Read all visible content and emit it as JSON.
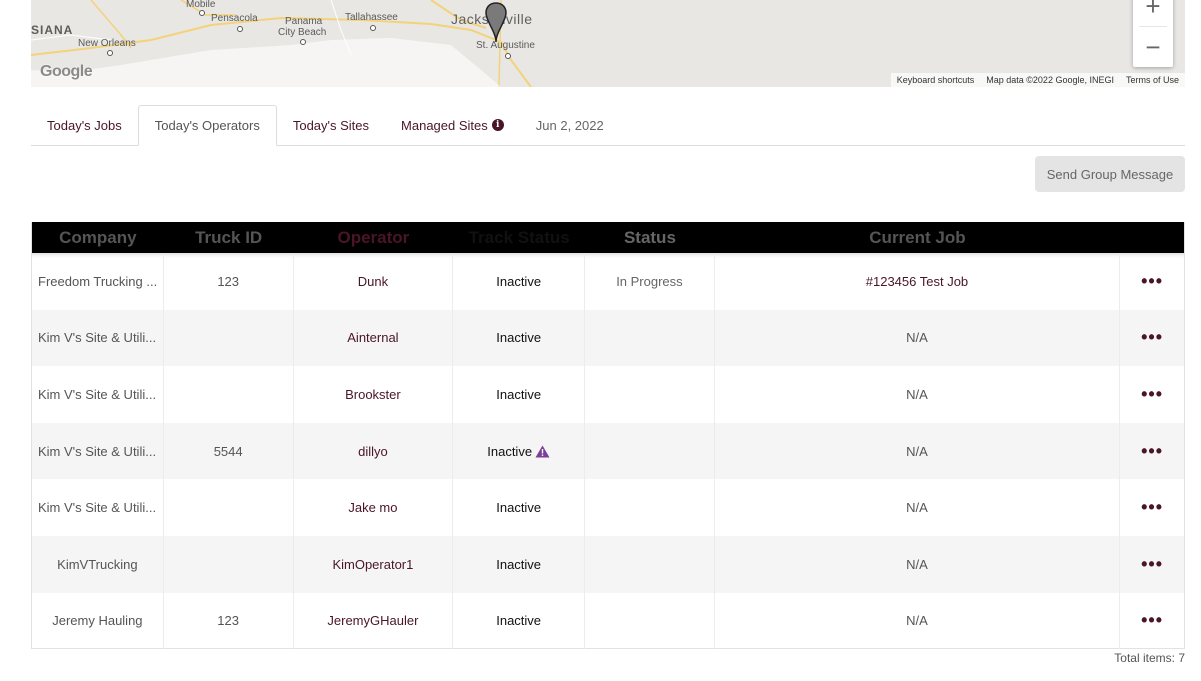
{
  "map": {
    "labels": {
      "mobile": "Mobile",
      "pensacola": "Pensacola",
      "panama": "Panama",
      "city_beach": "City Beach",
      "tallahassee": "Tallahassee",
      "jacksonville": "Jacksonville",
      "st_augustine": "St. Augustine",
      "state": "SIANA",
      "new_orleans": "New Orleans"
    },
    "google_logo": "Google",
    "attribution": {
      "shortcuts": "Keyboard shortcuts",
      "map_data": "Map data ©2022 Google, INEGI",
      "terms": "Terms of Use"
    },
    "zoom_in": "+",
    "zoom_out": "−",
    "icons": {
      "marker": "map-marker-icon"
    }
  },
  "tabs": [
    {
      "label": "Today's Jobs"
    },
    {
      "label": "Today's Operators"
    },
    {
      "label": "Today's Sites"
    },
    {
      "label": "Managed Sites"
    },
    {
      "label": "Jun 2, 2022"
    }
  ],
  "active_tab": "Today's Operators",
  "group_message_button": "Send Group Message",
  "table": {
    "headers": {
      "company": "Company",
      "truck_id": "Truck ID",
      "operator": "Operator",
      "track_status": "Track Status",
      "status": "Status",
      "current_job": "Current Job"
    },
    "rows": [
      {
        "company": "Freedom Trucking ...",
        "truck_id": "123",
        "operator": "Dunk",
        "track_status": "Inactive",
        "status": "In Progress",
        "current_job": "#123456 Test Job",
        "actions": "•••"
      },
      {
        "company": "Kim V's Site & Utili...",
        "truck_id": "",
        "operator": "Ainternal",
        "track_status": "Inactive",
        "status": "",
        "current_job": "N/A",
        "actions": "•••"
      },
      {
        "company": "Kim V's Site & Utili...",
        "truck_id": "",
        "operator": "Brookster",
        "track_status": "Inactive",
        "status": "",
        "current_job": "N/A",
        "actions": "•••"
      },
      {
        "company": "Kim V's Site & Utili...",
        "truck_id": "5544",
        "operator": "dillyo",
        "track_status": "Inactive",
        "status": "",
        "current_job": "N/A",
        "actions": "•••"
      },
      {
        "company": "Kim V's Site & Utili...",
        "truck_id": "",
        "operator": "Jake mo",
        "track_status": "Inactive",
        "status": "",
        "current_job": "N/A",
        "actions": "•••"
      },
      {
        "company": "KimVTrucking",
        "truck_id": "",
        "operator": "KimOperator1",
        "track_status": "Inactive",
        "status": "",
        "current_job": "N/A",
        "actions": "•••"
      },
      {
        "company": "Jeremy Hauling",
        "truck_id": "123",
        "operator": "JeremyGHauler",
        "track_status": "Inactive",
        "status": "",
        "current_job": "N/A",
        "actions": "•••"
      }
    ]
  },
  "total_items": "Total items: 7",
  "colors": {
    "brand": "#4a1528",
    "header_bg": "#000000",
    "warning": "#7b3f98"
  }
}
